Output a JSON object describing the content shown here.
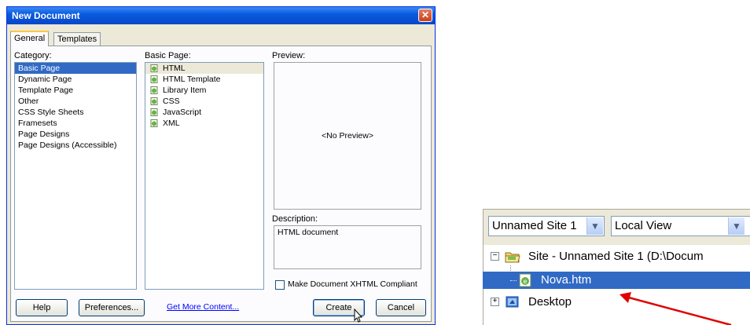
{
  "dialog": {
    "title": "New Document",
    "close_glyph": "✕",
    "tabs": [
      "General",
      "Templates"
    ],
    "category": {
      "label": "Category:",
      "items": [
        "Basic Page",
        "Dynamic Page",
        "Template Page",
        "Other",
        "CSS Style Sheets",
        "Framesets",
        "Page Designs",
        "Page Designs (Accessible)"
      ],
      "selected": "Basic Page"
    },
    "basic_page": {
      "label": "Basic Page:",
      "items": [
        "HTML",
        "HTML Template",
        "Library Item",
        "CSS",
        "JavaScript",
        "XML"
      ],
      "selected": "HTML",
      "icon": "document-icon"
    },
    "preview": {
      "label": "Preview:",
      "placeholder": "<No Preview>"
    },
    "description": {
      "label": "Description:",
      "text": "HTML document"
    },
    "xhtml_checkbox": {
      "label": "Make Document XHTML Compliant",
      "checked": false
    },
    "buttons": {
      "help": "Help",
      "preferences": "Preferences...",
      "get_more": "Get More Content...",
      "create": "Create",
      "cancel": "Cancel"
    }
  },
  "files_panel": {
    "site_select": "Unnamed Site 1",
    "view_select": "Local View",
    "tree": [
      {
        "label": "Site - Unnamed Site 1 (D:\\Docum",
        "icon": "folder-icon",
        "expander": "⊟"
      },
      {
        "label": "Nova.htm",
        "icon": "document-icon",
        "selected": true
      },
      {
        "label": "Desktop",
        "icon": "desktop-icon",
        "expander": "⊞"
      }
    ]
  },
  "colors": {
    "titlebar": "#0a5be0",
    "selection": "#316ac5",
    "arrow": "#e00000",
    "dialog_bg": "#ece9d8"
  }
}
